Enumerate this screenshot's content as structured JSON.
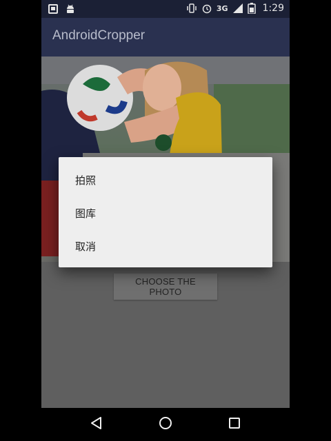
{
  "status_bar": {
    "network": "3G",
    "time": "1:29",
    "icons": [
      "notification-icon",
      "android-icon",
      "vibrate-icon",
      "alarm-icon",
      "signal-icon",
      "battery-icon"
    ]
  },
  "app_bar": {
    "title": "AndroidCropper"
  },
  "main": {
    "choose_button_label": "CHOOSE THE PHOTO"
  },
  "dialog": {
    "items": [
      {
        "label": "拍照"
      },
      {
        "label": "图库"
      },
      {
        "label": "取消"
      }
    ]
  },
  "nav_bar": {
    "icons": [
      "back-icon",
      "home-icon",
      "recents-icon"
    ]
  },
  "colors": {
    "status_bar": "#1b2035",
    "app_bar": "#2a3150",
    "dialog": "#eeeeee",
    "scrim_content": "#5f5f5f"
  }
}
